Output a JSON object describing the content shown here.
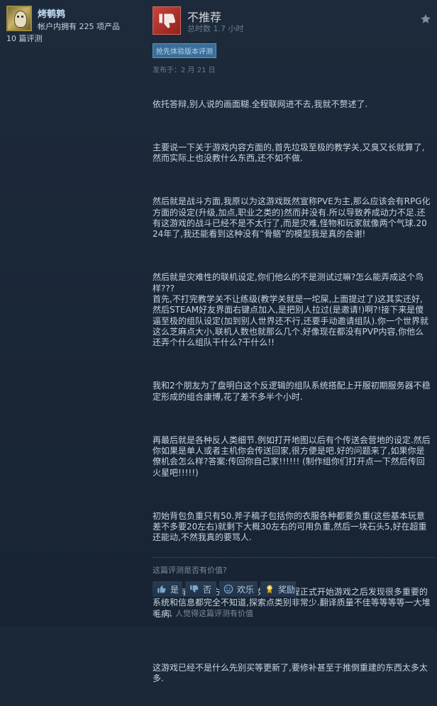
{
  "user": {
    "name": "烤鹌鹑",
    "products_owned": "帐户内拥有 225 项产品",
    "reviews": "10 篇评测"
  },
  "review": {
    "recommendation": "不推荐",
    "hours": "总时数 1.7 小时",
    "badge": "抢先体验版本评测",
    "posted": "发布于：2 月 21 日",
    "paragraphs": [
      "依托答辩,别人说的画面糊.全程联网进不去,我就不赘述了.",
      "主要说一下关于游戏内容方面的,首先垃圾至极的教学关,又臭又长就算了,然而实际上也没教什么东西,还不如不做.",
      "然后就是战斗方面,我原以为这游戏既然宣称PVE为主,那么应该会有RPG化方面的设定(升级,加点,职业之类的)然而并没有.所以导致养成动力不足.还有这游戏的战斗已经不是不太行了,而是灾难,怪物和玩家就像两个气球.2024年了,我还能看到这种没有“骨骼”的模型我是真的会谢!",
      "然后就是灾难性的联机设定,你们他么的不是测试过嘛?怎么能弄成这个鸟样???\n首先,不打完教学关不让练级(教学关就是一坨屎,上面提过了)这其实还好,然后STEAM好友界面右键点加入,是把别人拉过(是邀请!)啊?!接下来是傻逼至极的组队设定(加到别人世界还不行,还要手动邀请组队).你一个世界就这么芝麻点大小,联机人数也就那么几个.好像现在都没有PVP内容,你他么还弄个什么组队干什么?干什么!!",
      "我和2个朋友为了盘明白这个反逻辑的组队系统搭配上开服初期服务器不稳定形成的组合康博,花了差不多半个小时.",
      "再最后就是各种反人类细节.例如打开地图以后有个传送会营地的设定.然后你如果是单人或者主机你会传送回家,很方便是吧.好的问题来了,如果你是僚机会怎么样?答案:传回你自己家!!!!!! (制作组你们打开点一下然后传回火星吧!!!!!)",
      "初始背包负重只有50.斧子稿子包括你的衣服各种都要负重(这些基本玩意差不多要20左右)就剩下大概30左右的可用负重,然后一块石头5,好在超重还能动,不然我真的要骂人.",
      "\n其实还有很多地方都不行,比如打完教程正式开始游戏之后发现很多重要的系统和信息都完全不知道,探索点类别非常少.翻译质量不佳等等等等一大堆毛病.",
      "\n这游戏已经不是什么先别买等更新了,要修补甚至于推倒重建的东西太多太多."
    ]
  },
  "feedback": {
    "question": "这篇评测是否有价值?",
    "yes": "是",
    "no": "否",
    "funny": "欢乐",
    "award": "奖励",
    "summary": "有 11 人觉得这篇评测有价值"
  },
  "icons": {
    "thumb": "thumbs-down-icon",
    "received": "free-received-icon",
    "yes": "thumbs-up-icon",
    "no": "thumbs-down-icon",
    "funny": "smiley-icon",
    "award": "award-icon"
  },
  "colors": {
    "background": "#1b2838",
    "not_recommended": "#a72f28",
    "badge": "#3a6e98",
    "username": "#c1dbf4",
    "award_icon": "#f0c040"
  }
}
